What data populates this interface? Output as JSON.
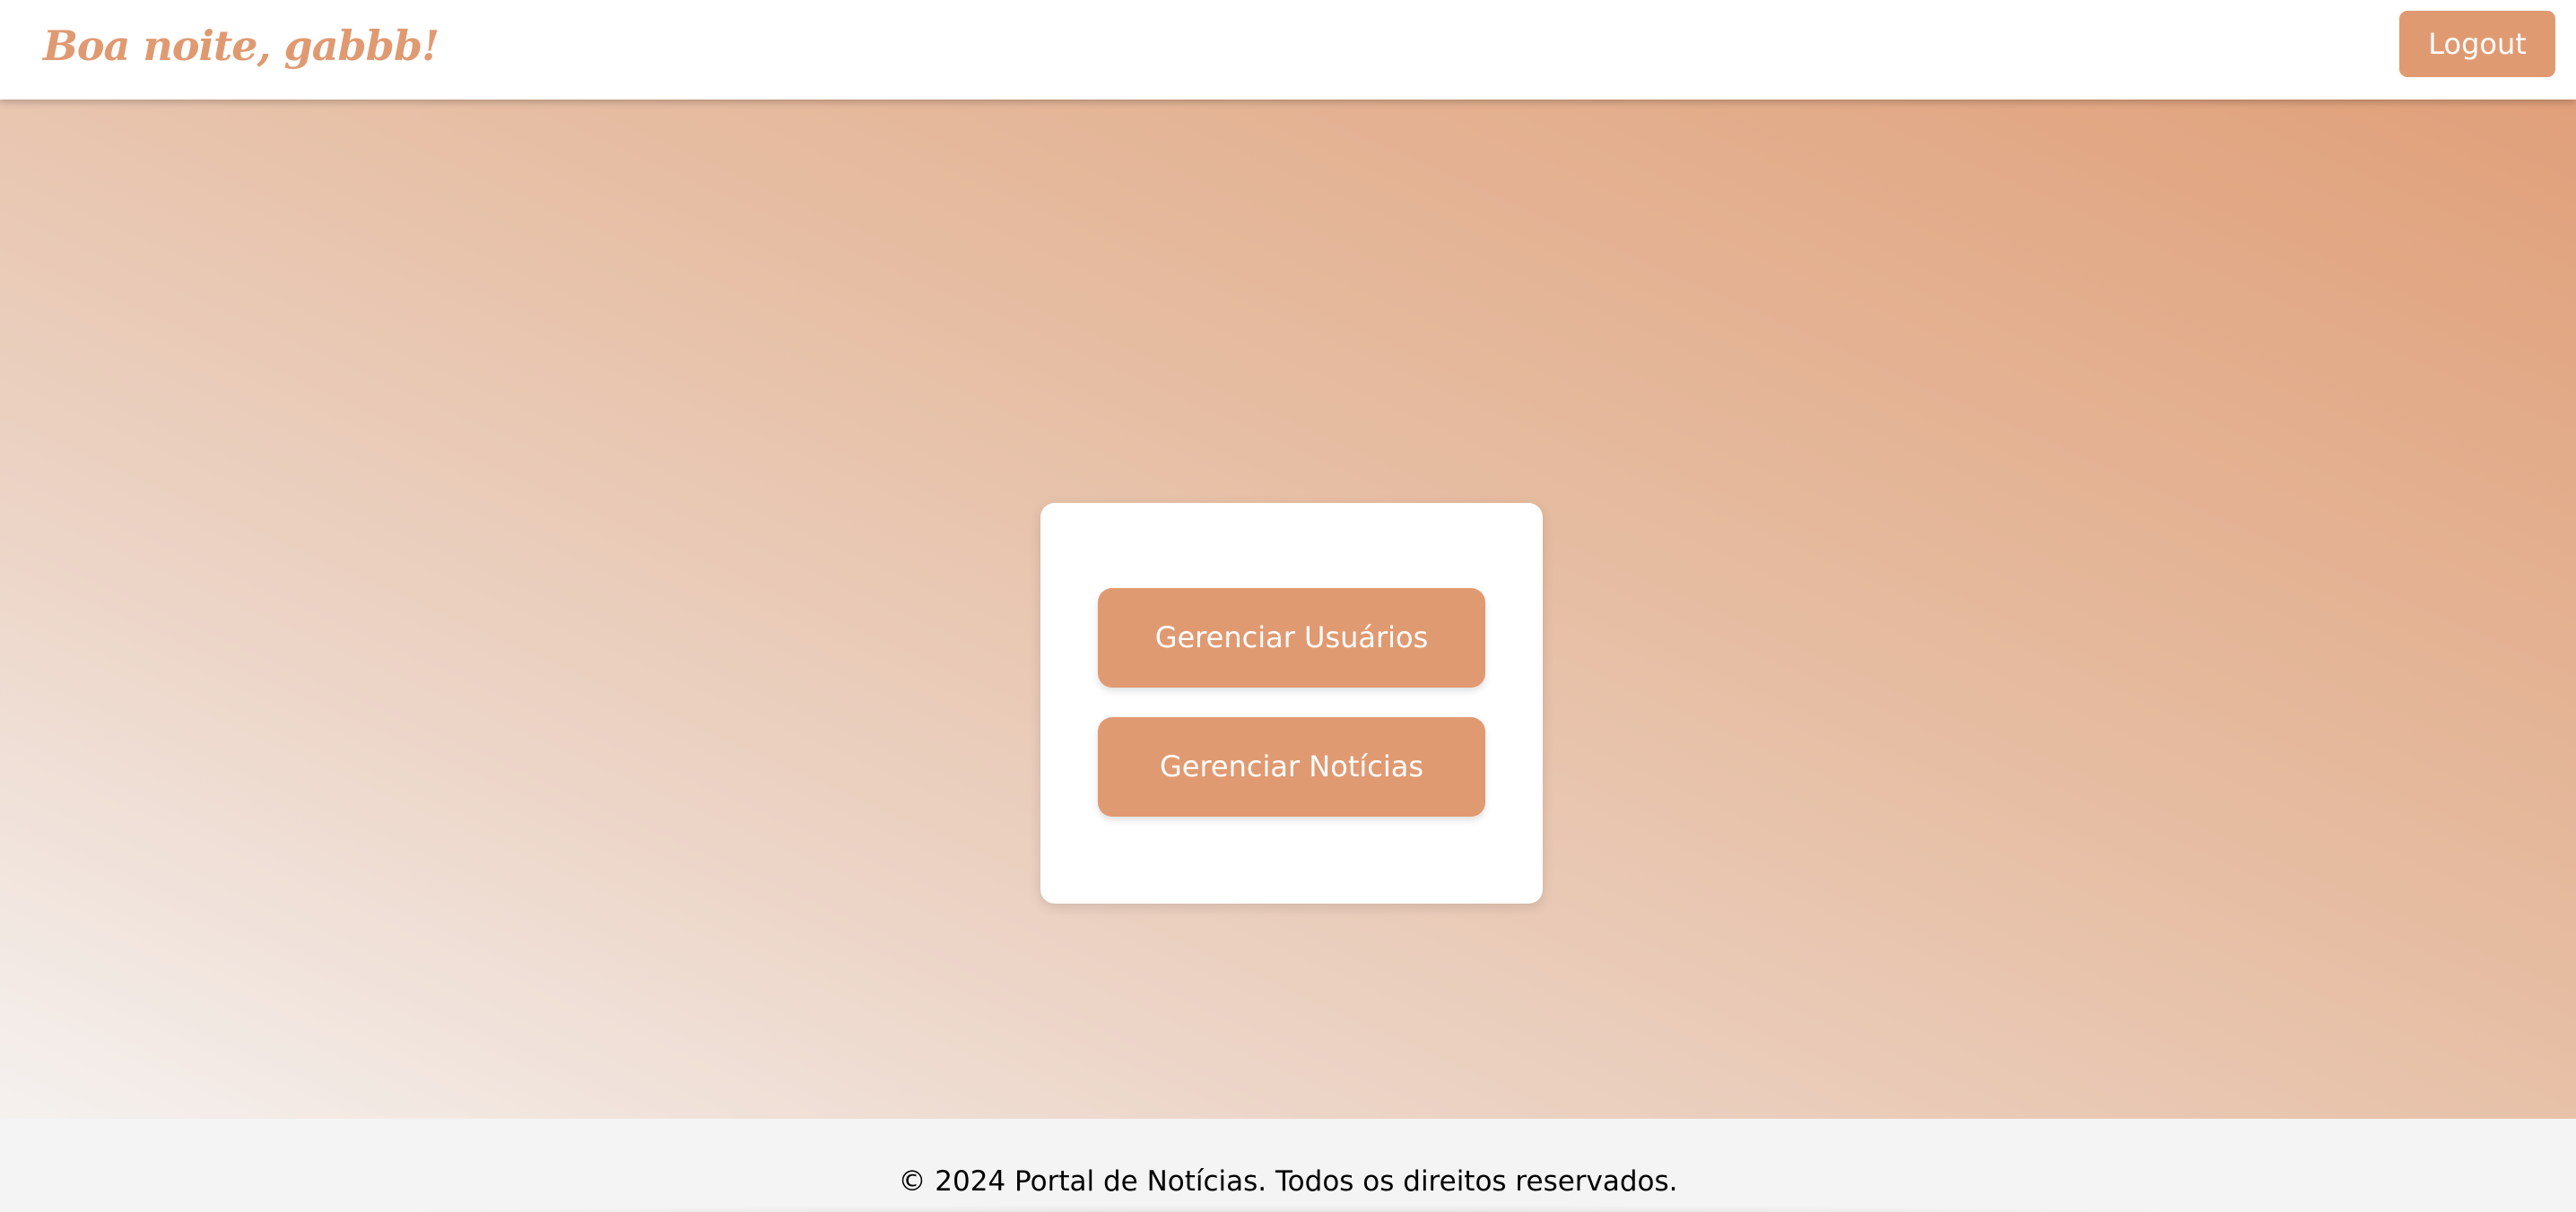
{
  "header": {
    "greeting": "Boa noite, gabbb!",
    "logout_label": "Logout"
  },
  "dashboard": {
    "manage_users_label": "Gerenciar Usuários",
    "manage_news_label": "Gerenciar Notícias"
  },
  "footer": {
    "copyright": "© 2024 Portal de Notícias. Todos os direitos reservados."
  },
  "colors": {
    "accent": "#e09a72",
    "footer_bg": "#f4f4f4",
    "gradient_start": "#f5f1ef",
    "gradient_end": "#e0a07a"
  }
}
